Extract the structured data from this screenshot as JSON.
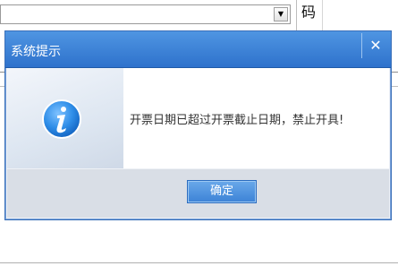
{
  "background": {
    "code_label": "码"
  },
  "dialog": {
    "title": "系统提示",
    "close_symbol": "✕",
    "icon": "info-icon",
    "message": "开票日期已超过开票截止日期，禁止开具!",
    "ok_label": "确定"
  },
  "colors": {
    "titlebar": "#3c82d6",
    "button": "#4a8fdf",
    "footer": "#d9dee6"
  }
}
